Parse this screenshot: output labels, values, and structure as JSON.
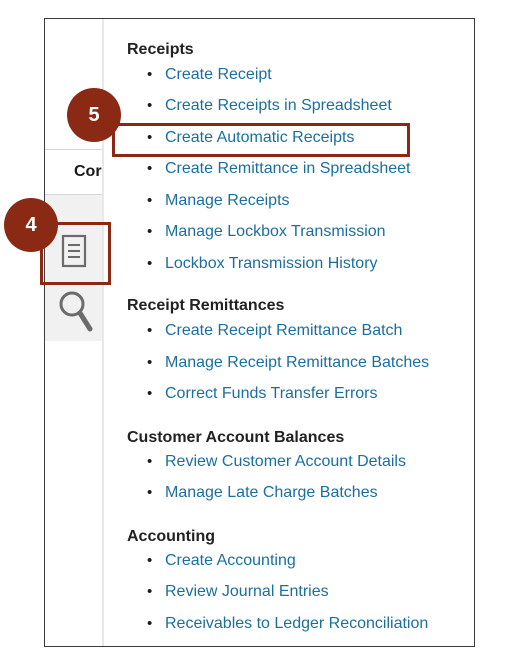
{
  "rail": {
    "tab_text": "Cor",
    "icons": [
      "document-icon",
      "search-icon"
    ]
  },
  "sections": [
    {
      "heading": "Receipts",
      "items": [
        "Create Receipt",
        "Create Receipts in Spreadsheet",
        "Create Automatic Receipts",
        "Create Remittance in Spreadsheet",
        "Manage Receipts",
        "Manage Lockbox Transmission",
        "Lockbox Transmission History"
      ]
    },
    {
      "heading": "Receipt Remittances",
      "items": [
        "Create Receipt Remittance Batch",
        "Manage Receipt Remittance Batches",
        "Correct Funds Transfer Errors"
      ]
    },
    {
      "heading": "Customer Account Balances",
      "items": [
        "Review Customer Account Details",
        "Manage Late Charge Batches"
      ]
    },
    {
      "heading": "Accounting",
      "items": [
        "Create Accounting",
        "Review Journal Entries",
        "Receivables to Ledger Reconciliation"
      ]
    }
  ],
  "callouts": {
    "step_4": "4",
    "step_5": "5"
  },
  "colors": {
    "link": "#1b6f9f",
    "callout": "#8b2a14"
  }
}
